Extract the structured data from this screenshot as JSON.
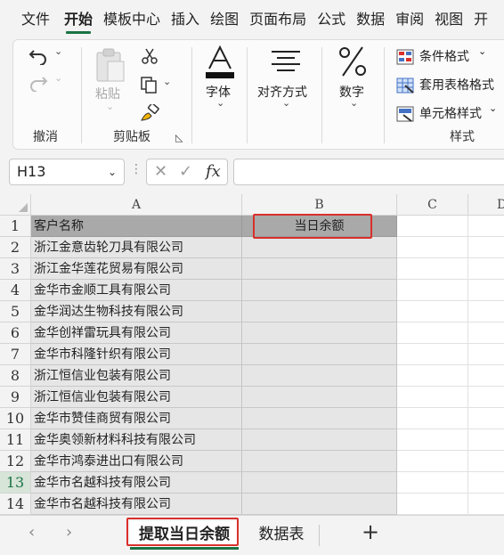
{
  "menu": {
    "tabs": [
      "文件",
      "开始",
      "模板中心",
      "插入",
      "绘图",
      "页面布局",
      "公式",
      "数据",
      "审阅",
      "视图",
      "开"
    ],
    "active_index": 1
  },
  "ribbon": {
    "undo_group": "撤消",
    "clipboard_group": "剪贴板",
    "paste": "粘贴",
    "font": "字体",
    "align": "对齐方式",
    "number": "数字",
    "cond_format": "条件格式",
    "table_format": "套用表格格式",
    "cell_style": "单元格样式",
    "style_group": "样式",
    "chevron": "⌄"
  },
  "formula_bar": {
    "name_box": "H13",
    "dropdown": "⌄",
    "dots": "⋮",
    "cancel": "✕",
    "enter": "✓",
    "fx": "fx",
    "value": ""
  },
  "grid": {
    "columns": [
      "A",
      "B",
      "C",
      "D"
    ],
    "rows": [
      {
        "num": "1",
        "a": "客户名称",
        "b": "当日余额"
      },
      {
        "num": "2",
        "a": "浙江金意齿轮刀具有限公司",
        "b": ""
      },
      {
        "num": "3",
        "a": "浙江金华莲花贸易有限公司",
        "b": ""
      },
      {
        "num": "4",
        "a": "金华市金顺工具有限公司",
        "b": ""
      },
      {
        "num": "5",
        "a": "金华润达生物科技有限公司",
        "b": ""
      },
      {
        "num": "6",
        "a": "金华创祥雷玩具有限公司",
        "b": ""
      },
      {
        "num": "7",
        "a": "金华市科隆针织有限公司",
        "b": ""
      },
      {
        "num": "8",
        "a": "浙江恒信业包装有限公司",
        "b": ""
      },
      {
        "num": "9",
        "a": "浙江恒信业包装有限公司",
        "b": ""
      },
      {
        "num": "10",
        "a": "金华市赞佳商贸有限公司",
        "b": ""
      },
      {
        "num": "11",
        "a": "金华奥领新材料科技有限公司",
        "b": ""
      },
      {
        "num": "12",
        "a": "金华市鸿泰进出口有限公司",
        "b": ""
      },
      {
        "num": "13",
        "a": "金华市名越科技有限公司",
        "b": ""
      },
      {
        "num": "14",
        "a": "金华市名越科技有限公司",
        "b": ""
      }
    ]
  },
  "sheets": {
    "prev": "‹",
    "next": "›",
    "tabs": [
      "提取当日余额",
      "数据表"
    ],
    "add": "+"
  },
  "colors": {
    "accent": "#1a7343",
    "highlight": "#d9302c"
  }
}
